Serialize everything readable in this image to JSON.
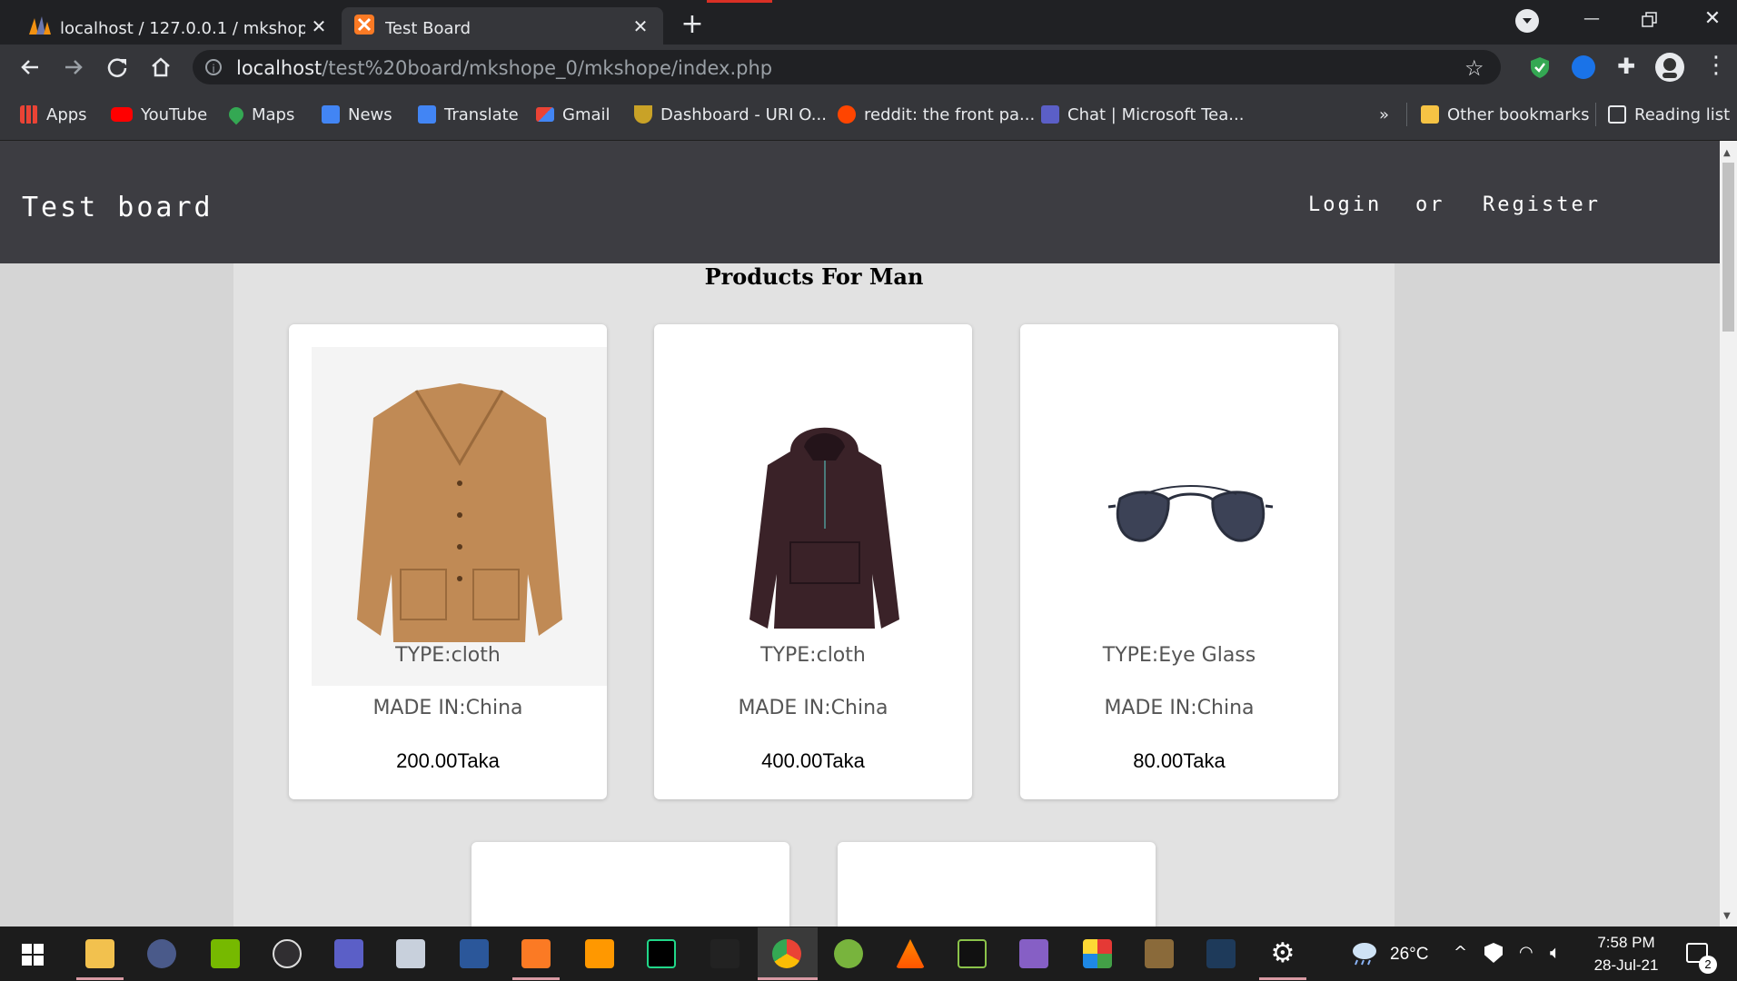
{
  "browser": {
    "tabs": [
      {
        "title": "localhost / 127.0.0.1 / mkshope /",
        "active": false
      },
      {
        "title": "Test Board",
        "active": true
      }
    ],
    "new_tab_label": "+",
    "url_host": "localhost",
    "url_path": "/test%20board/mkshope_0/mkshope/index.php",
    "bookmarks": [
      {
        "label": "Apps",
        "icon": "apps-grid-icon"
      },
      {
        "label": "YouTube",
        "icon": "youtube-icon"
      },
      {
        "label": "Maps",
        "icon": "maps-pin-icon"
      },
      {
        "label": "News",
        "icon": "news-icon"
      },
      {
        "label": "Translate",
        "icon": "translate-icon"
      },
      {
        "label": "Gmail",
        "icon": "gmail-icon"
      },
      {
        "label": "Dashboard - URI O...",
        "icon": "trophy-icon"
      },
      {
        "label": "reddit: the front pa...",
        "icon": "reddit-icon"
      },
      {
        "label": "Chat | Microsoft Tea...",
        "icon": "teams-icon"
      }
    ],
    "overflow_label": "»",
    "other_bookmarks": "Other bookmarks",
    "reading_list": "Reading list"
  },
  "site": {
    "title": "Test board",
    "login": "Login",
    "or": "or",
    "register": "Register",
    "section_title": "Products For Man",
    "products": [
      {
        "type": "TYPE:cloth",
        "made": "MADE IN:China",
        "price": "200.00Taka",
        "image": "brown-jacket"
      },
      {
        "type": "TYPE:cloth",
        "made": "MADE IN:China",
        "price": "400.00Taka",
        "image": "dark-hoodie"
      },
      {
        "type": "TYPE:Eye Glass",
        "made": "MADE IN:China",
        "price": "80.00Taka",
        "image": "aviator-sunglasses"
      }
    ]
  },
  "taskbar": {
    "weather": "26°C",
    "time": "7:58 PM",
    "date": "28-Jul-21",
    "notifications": "2"
  },
  "colors": {
    "header_bg": "#3d3d42",
    "page_bg": "#d5d5d5",
    "content_bg": "#e2e2e2",
    "browser_dark": "#202124",
    "toolbar": "#35363a"
  }
}
